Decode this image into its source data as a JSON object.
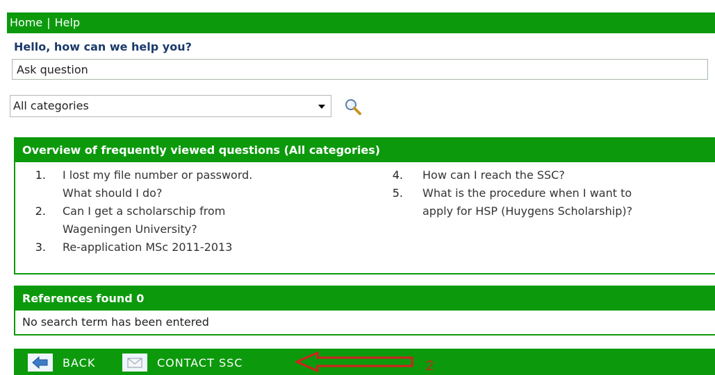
{
  "topnav": {
    "home": "Home",
    "separator": "|",
    "help": "Help"
  },
  "greeting": "Hello, how can we help you?",
  "search": {
    "value": "Ask question"
  },
  "category_select": {
    "selected": "All categories"
  },
  "faq": {
    "title": "Overview of frequently viewed questions (All categories)",
    "left": [
      {
        "num": "1.",
        "lines": [
          "I lost my file number or password.",
          "What should I do?"
        ]
      },
      {
        "num": "2.",
        "lines": [
          "Can I get a scholarschip from",
          "Wageningen University?"
        ]
      },
      {
        "num": "3.",
        "lines": [
          "Re-application MSc 2011-2013"
        ]
      }
    ],
    "right": [
      {
        "num": "4.",
        "lines": [
          "How can I reach the SSC?"
        ]
      },
      {
        "num": "5.",
        "lines": [
          "What is the procedure when I want to",
          "apply for HSP (Huygens Scholarship)?"
        ]
      }
    ]
  },
  "references": {
    "title": "References found 0",
    "message": "No search term has been entered"
  },
  "footer": {
    "back_label": "BACK",
    "contact_label": "CONTACT SSC"
  },
  "annotation": {
    "label": "2",
    "color": "#d32020"
  },
  "colors": {
    "brand_green": "#0c9a0c",
    "title_blue": "#1a3a6a"
  }
}
